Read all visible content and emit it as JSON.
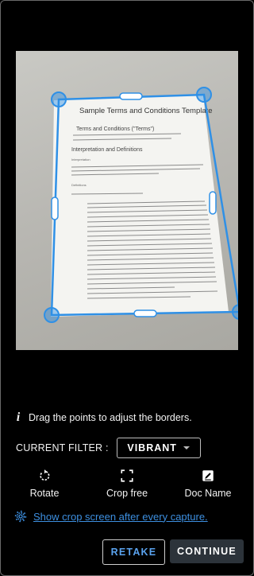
{
  "document_preview": {
    "title": "Sample Terms and Conditions Template",
    "subtitle": "Terms and Conditions (\"Terms\")",
    "section1": "Interpretation and Definitions",
    "section2": "Interpretation",
    "section3": "Definitions"
  },
  "hint": {
    "text": "Drag the points to adjust the borders.",
    "icon": "info-icon"
  },
  "filter": {
    "label": "CURRENT FILTER :",
    "value": "VIBRANT"
  },
  "tools": [
    {
      "label": "Rotate",
      "icon": "rotate-icon"
    },
    {
      "label": "Crop free",
      "icon": "crop-free-icon"
    },
    {
      "label": "Doc Name",
      "icon": "edit-doc-name-icon"
    }
  ],
  "settings_link": {
    "text": "Show crop screen after every capture.",
    "icon": "gear-icon"
  },
  "buttons": {
    "retake": "RETAKE",
    "continue": "CONTINUE"
  },
  "colors": {
    "accent": "#3d8fe0",
    "crop_frame": "#2f90e6",
    "background": "#000000"
  }
}
